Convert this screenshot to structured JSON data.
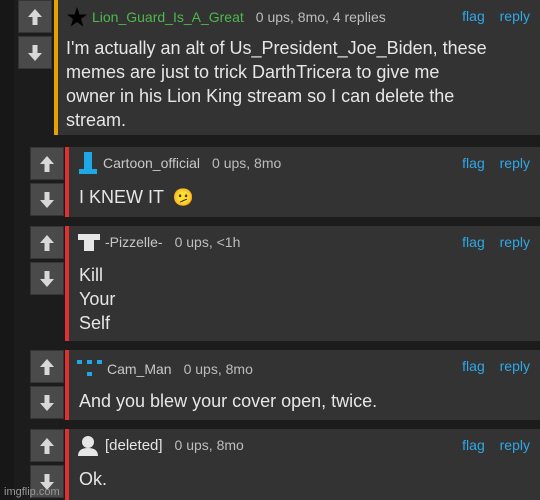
{
  "comments": [
    {
      "username": "Lion_Guard_Is_A_Great",
      "stats": "0 ups, 8mo, 4 replies",
      "text": "I'm actually an alt of Us_President_Joe_Biden, these\nmemes are just to trick DarthTricera to give me\nowner in his Lion King stream so I can delete the\nstream.",
      "icon": "star-icon",
      "name_color": "#4db84d",
      "bar_color": "#e8a100"
    },
    {
      "username": "Cartoon_official",
      "stats": "0 ups, 8mo",
      "text": "I KNEW IT",
      "emoji": "🫤",
      "icon": "blue-figure-icon",
      "name_color": "#c8c8c8",
      "bar_color": "#e03030"
    },
    {
      "username": "-Pizzelle-",
      "stats": "0 ups, <1h",
      "text": "Kill\nYour\nSelf",
      "icon": "white-shirt-icon",
      "name_color": "#c8c8c8",
      "bar_color": "#e03030"
    },
    {
      "username": "Cam_Man",
      "stats": "0 ups, 8mo",
      "text": "And you blew your cover open, twice.",
      "icon": "dotted-pattern-icon",
      "name_color": "#c8c8c8",
      "bar_color": "#e03030"
    },
    {
      "username": "[deleted]",
      "stats": "0 ups, 8mo",
      "text": "Ok.",
      "icon": "default-avatar-icon",
      "name_color": "#e6e6e6",
      "bar_color": "#e03030"
    }
  ],
  "actions": {
    "flag": "flag",
    "reply": "reply"
  },
  "watermark": "imgflip.com"
}
